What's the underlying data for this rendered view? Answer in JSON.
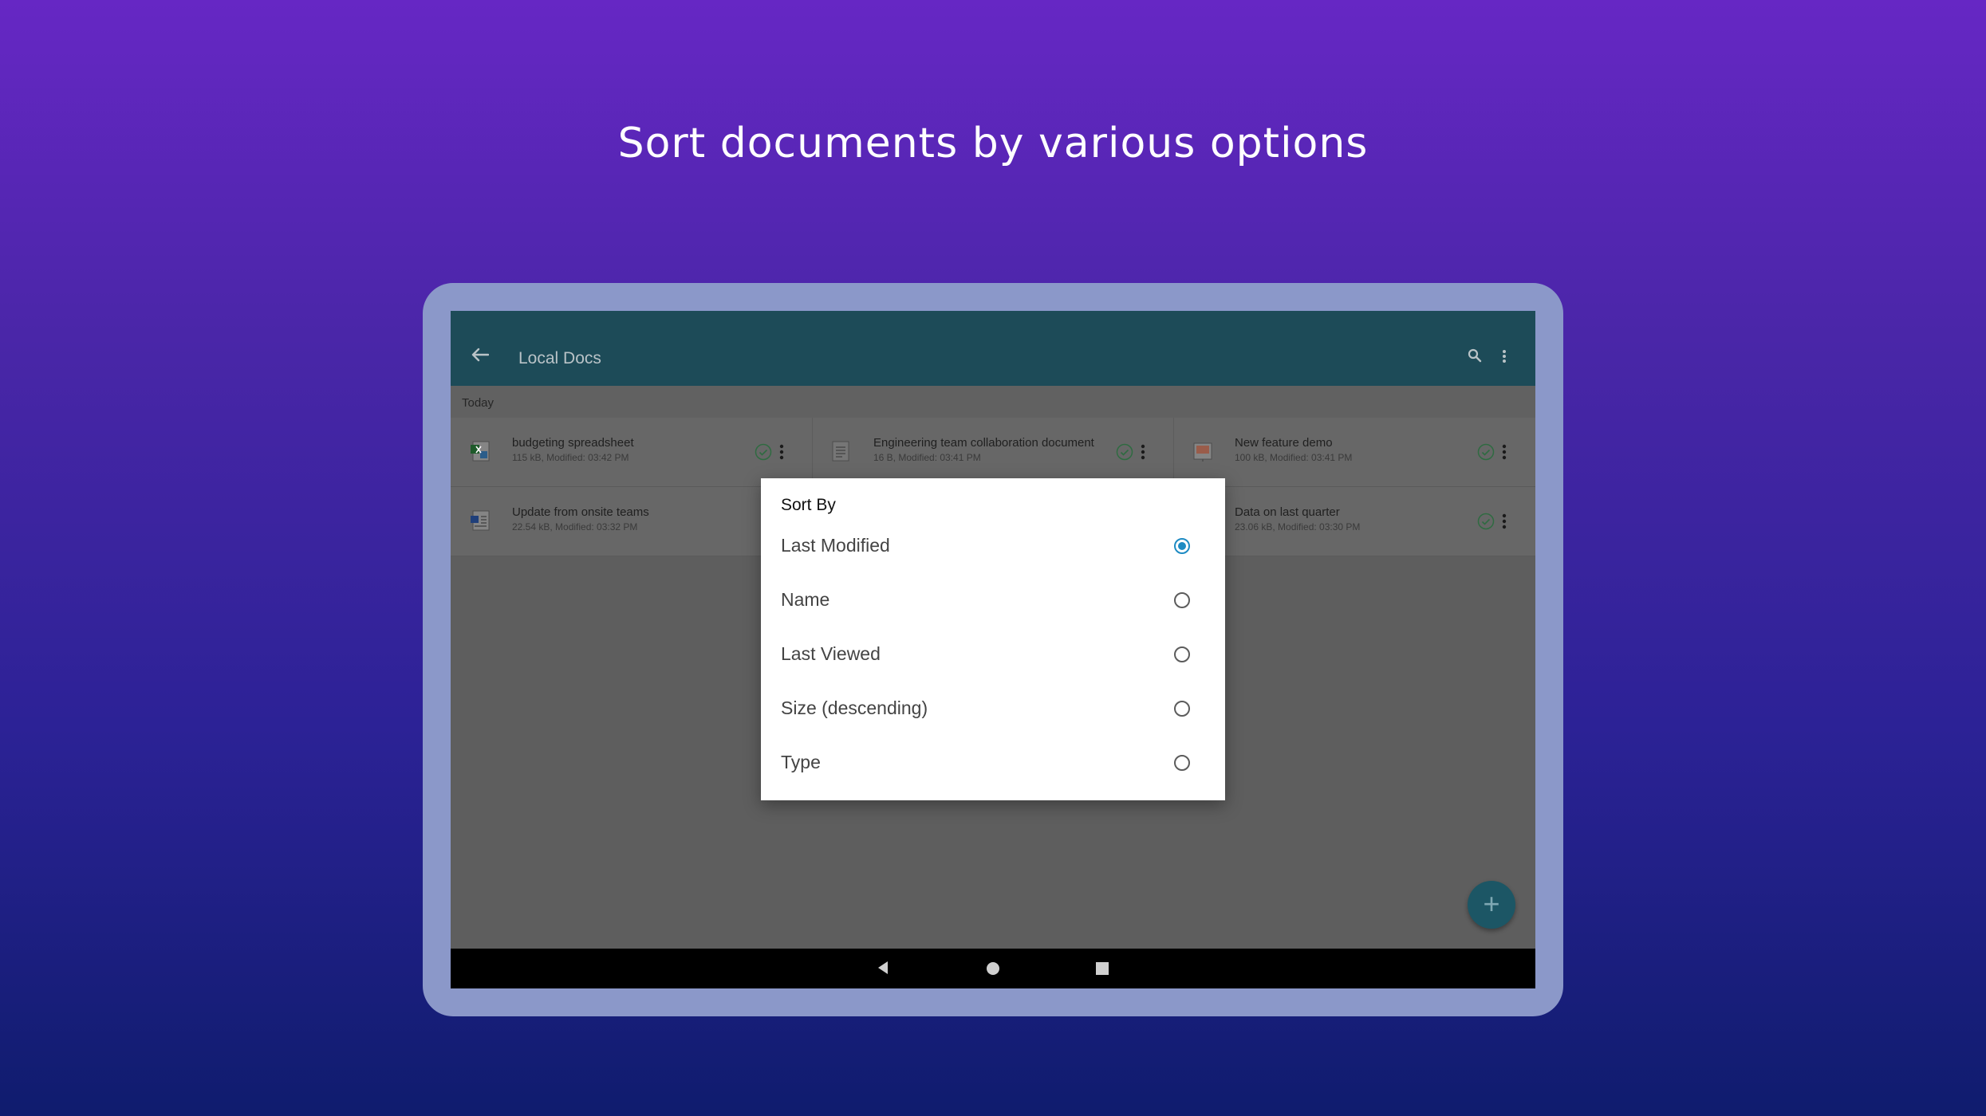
{
  "headline": "Sort documents by various options",
  "appbar": {
    "title": "Local Docs"
  },
  "section_label": "Today",
  "files": [
    {
      "name": "budgeting spreadsheet",
      "meta": "115 kB, Modified: 03:42 PM",
      "icon": "spreadsheet-icon"
    },
    {
      "name": "Engineering team collaboration document",
      "meta": "16 B, Modified: 03:41 PM",
      "icon": "text-document-icon"
    },
    {
      "name": "New feature demo",
      "meta": "100 kB, Modified: 03:41 PM",
      "icon": "presentation-icon"
    },
    {
      "name": "Update from onsite teams",
      "meta": "22.54 kB, Modified: 03:32 PM",
      "icon": "word-document-icon"
    },
    {
      "name": "Data on last quarter",
      "meta": "23.06 kB, Modified: 03:30 PM",
      "icon": "spreadsheet-icon"
    }
  ],
  "dialog": {
    "title": "Sort By",
    "options": [
      {
        "label": "Last Modified",
        "selected": true
      },
      {
        "label": "Name",
        "selected": false
      },
      {
        "label": "Last Viewed",
        "selected": false
      },
      {
        "label": "Size (descending)",
        "selected": false
      },
      {
        "label": "Type",
        "selected": false
      }
    ]
  },
  "fab": {
    "label": "+"
  },
  "colors": {
    "accent": "#1e8bc3",
    "appbar": "#1d4b58",
    "tablet_frame": "#8b98c9"
  }
}
